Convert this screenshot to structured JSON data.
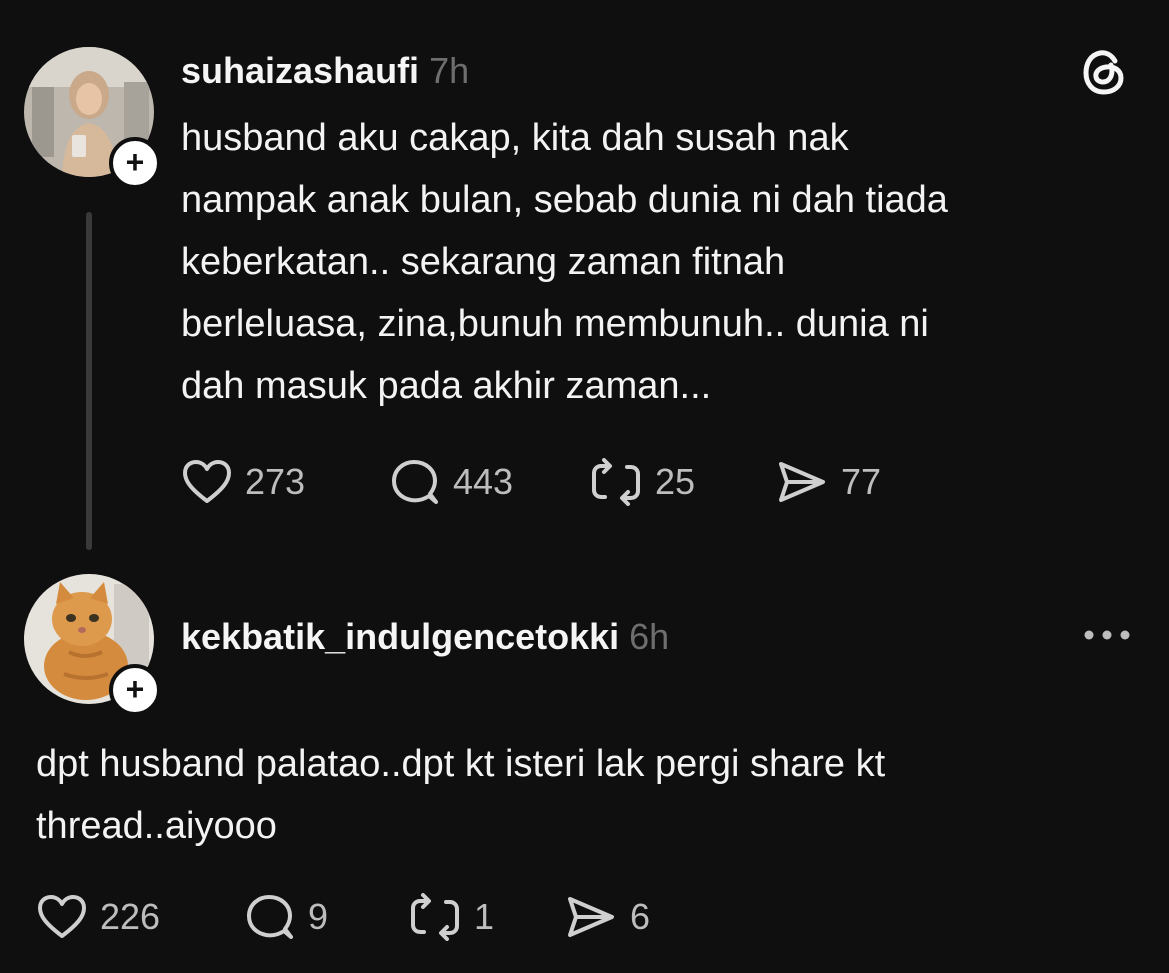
{
  "post": {
    "username": "suhaizashaufi",
    "time": "7h",
    "text_lines": [
      "husband aku cakap, kita dah susah nak",
      "nampak anak bulan, sebab dunia ni dah tiada",
      "keberkatan.. sekarang zaman fitnah",
      "berleluasa, zina,bunuh membunuh.. dunia ni",
      "dah masuk pada akhir zaman..."
    ],
    "likes": "273",
    "replies": "443",
    "reposts": "25",
    "shares": "77"
  },
  "reply": {
    "username": "kekbatik_indulgencetokki",
    "time": "6h",
    "text_lines": [
      "dpt husband palatao..dpt kt isteri lak pergi share kt",
      "thread..aiyooo"
    ],
    "likes": "226",
    "replies": "9",
    "reposts": "1",
    "shares": "6"
  },
  "icons": {
    "brand": "threads-logo-icon",
    "follow": "plus-icon",
    "like": "heart-icon",
    "reply": "speech-bubble-icon",
    "repost": "repost-icon",
    "share": "send-icon",
    "more": "more-dots-icon"
  },
  "colors": {
    "background": "#0f0f0f",
    "text": "#f3f3f3",
    "muted": "#6e6e6e",
    "thread_line": "#3a3a3a"
  }
}
